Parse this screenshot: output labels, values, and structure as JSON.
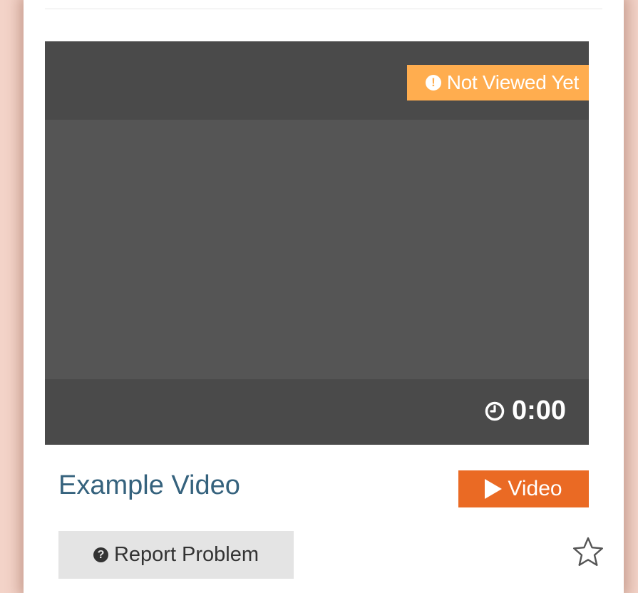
{
  "card": {
    "status_badge": {
      "label": "Not Viewed Yet",
      "icon": "exclamation-circle-icon",
      "color": "#ffad4f"
    },
    "duration": {
      "text": "0:00",
      "icon": "clock-icon"
    },
    "title": "Example Video",
    "type_badge": {
      "label": "Video",
      "icon": "play-icon",
      "color": "#ea6a24"
    },
    "report_button": {
      "label": "Report Problem",
      "icon": "question-circle-icon"
    },
    "favorite": {
      "icon": "star-outline-icon",
      "favorited": false
    }
  },
  "colors": {
    "page_background": "#f3d3c8",
    "thumbnail": "#555555",
    "title_link": "#35627d"
  }
}
